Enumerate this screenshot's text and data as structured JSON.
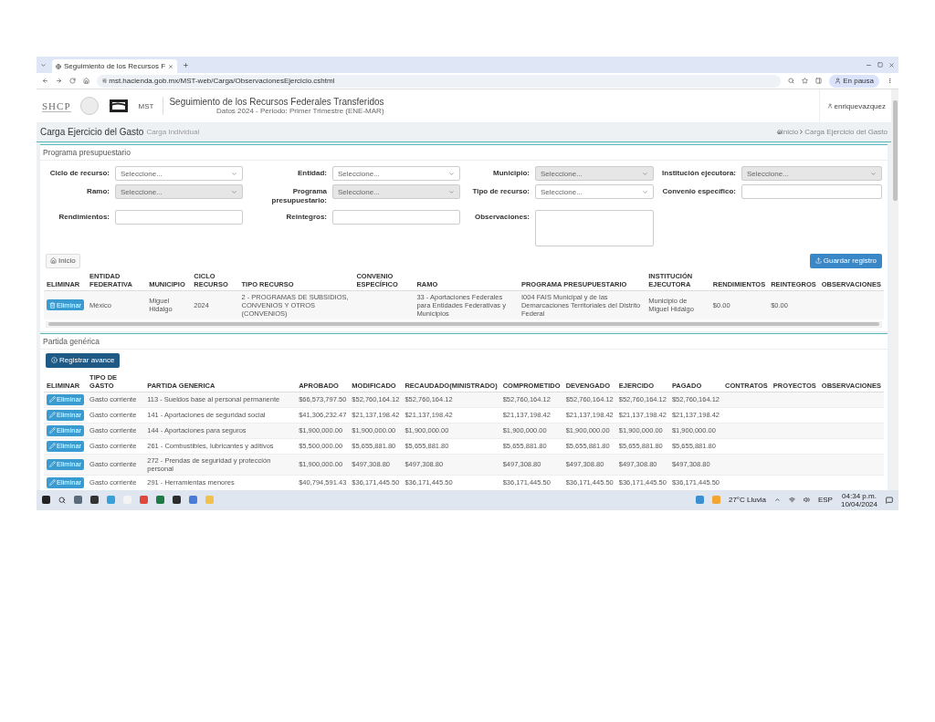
{
  "browser": {
    "tab_title": "Seguimiento de los Recursos F",
    "url": "mst.hacienda.gob.mx/MST-web/Carga/ObservacionesEjercicio.cshtml",
    "profile_label": "En pausa"
  },
  "header": {
    "org_logo_text": "SHCP",
    "app_logo_text": "MST",
    "title": "Seguimiento de los Recursos Federales Transferidos",
    "subtitle": "Datos 2024 - Periodo: Primer Trimestre (ENE-MAR)",
    "user": "enriquevazquez"
  },
  "page": {
    "title": "Carga Ejercicio del Gasto",
    "subtitle": "Carga Individual",
    "breadcrumb": [
      "Inicio",
      "Carga Ejercicio del Gasto"
    ]
  },
  "budget_panel": {
    "heading": "Programa presupuestario",
    "fields": [
      {
        "label": "Ciclo de recurso:",
        "kind": "select",
        "value": "Seleccione...",
        "disabled": false
      },
      {
        "label": "Entidad:",
        "kind": "select",
        "value": "Seleccione...",
        "disabled": false
      },
      {
        "label": "Municipio:",
        "kind": "select",
        "value": "Seleccione...",
        "disabled": true
      },
      {
        "label": "Institución ejecutora:",
        "kind": "select",
        "value": "Seleccione...",
        "disabled": true
      },
      {
        "label": "Ramo:",
        "kind": "select",
        "value": "Seleccione...",
        "disabled": true
      },
      {
        "label": "Programa presupuestario:",
        "kind": "select",
        "value": "Seleccione...",
        "disabled": true
      },
      {
        "label": "Tipo de recurso:",
        "kind": "select",
        "value": "Seleccione...",
        "disabled": false
      },
      {
        "label": "Convenio específico:",
        "kind": "input",
        "disabled": false
      },
      {
        "label": "Rendimientos:",
        "kind": "input",
        "disabled": false
      },
      {
        "label": "Reintegros:",
        "kind": "input",
        "disabled": false
      },
      {
        "label": "Observaciones:",
        "kind": "textarea",
        "disabled": false
      }
    ],
    "home_button": "Inicio",
    "save_button": "Guardar registro",
    "table": {
      "columns": [
        "ELIMINAR",
        "ENTIDAD FEDERATIVA",
        "MUNICIPIO",
        "CICLO RECURSO",
        "TIPO RECURSO",
        "CONVENIO ESPECÍFICO",
        "RAMO",
        "PROGRAMA PRESUPUESTARIO",
        "INSTITUCIÓN EJECUTORA",
        "RENDIMIENTOS",
        "REINTEGROS",
        "OBSERVACIONES"
      ],
      "rows": [
        {
          "cells": [
            "Eliminar",
            "México",
            "Miguel Hidalgo",
            "2024",
            "2 - PROGRAMAS DE SUBSIDIOS, CONVENIOS Y OTROS (CONVENIOS)",
            "",
            "33 - Aportaciones Federales para Entidades Federativas y Municipios",
            "I004 FAIS Municipal y de las Demarcaciones Territoriales del Distrito Federal",
            "Municipio de Miguel Hidalgo",
            "$0.00",
            "$0.00",
            ""
          ]
        }
      ]
    }
  },
  "partida_panel": {
    "heading": "Partida genérica",
    "add_button": "Registrar avance",
    "table": {
      "columns": [
        "ELIMINAR",
        "TIPO DE GASTO",
        "PARTIDA GENERICA",
        "APROBADO",
        "MODIFICADO",
        "RECAUDADO(MINISTRADO)",
        "COMPROMETIDO",
        "DEVENGADO",
        "EJERCIDO",
        "PAGADO",
        "CONTRATOS",
        "PROYECTOS",
        "OBSERVACIONES"
      ],
      "rows": [
        {
          "cells": [
            "Eliminar",
            "Gasto corriente",
            "113 - Sueldos base al personal permanente",
            "$66,573,797.50",
            "$52,760,164.12",
            "$52,760,164.12",
            "$52,760,164.12",
            "$52,760,164.12",
            "$52,760,164.12",
            "$52,760,164.12",
            "",
            "",
            ""
          ]
        },
        {
          "cells": [
            "Eliminar",
            "Gasto corriente",
            "141 - Aportaciones de seguridad social",
            "$41,306,232.47",
            "$21,137,198.42",
            "$21,137,198.42",
            "$21,137,198.42",
            "$21,137,198.42",
            "$21,137,198.42",
            "$21,137,198.42",
            "",
            "",
            ""
          ]
        },
        {
          "cells": [
            "Eliminar",
            "Gasto corriente",
            "144 - Aportaciones para seguros",
            "$1,900,000.00",
            "$1,900,000.00",
            "$1,900,000.00",
            "$1,900,000.00",
            "$1,900,000.00",
            "$1,900,000.00",
            "$1,900,000.00",
            "",
            "",
            ""
          ]
        },
        {
          "cells": [
            "Eliminar",
            "Gasto corriente",
            "261 - Combustibles, lubricantes y aditivos",
            "$5,500,000.00",
            "$5,655,881.80",
            "$5,655,881.80",
            "$5,655,881.80",
            "$5,655,881.80",
            "$5,655,881.80",
            "$5,655,881.80",
            "",
            "",
            ""
          ]
        },
        {
          "cells": [
            "Eliminar",
            "Gasto corriente",
            "272 - Prendas de seguridad y protección personal",
            "$1,900,000.00",
            "$497,308.80",
            "$497,308.80",
            "$497,308.80",
            "$497,308.80",
            "$497,308.80",
            "$497,308.80",
            "",
            "",
            ""
          ]
        },
        {
          "cells": [
            "Eliminar",
            "Gasto corriente",
            "291 - Herramientas menores",
            "$40,794,591.43",
            "$36,171,445.50",
            "$36,171,445.50",
            "$36,171,445.50",
            "$36,171,445.50",
            "$36,171,445.50",
            "$36,171,445.50",
            "",
            "",
            ""
          ]
        }
      ]
    }
  },
  "taskbar": {
    "weather": "27°C Lluvia",
    "language": "ESP",
    "time": "04:34 p.m.",
    "date": "10/04/2024"
  }
}
